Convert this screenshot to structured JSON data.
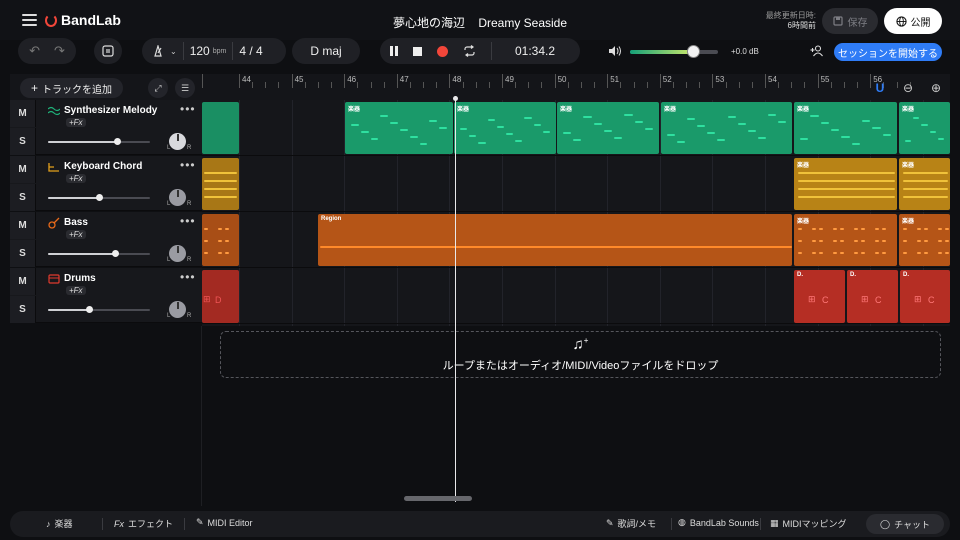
{
  "header": {
    "app_name": "BandLab",
    "project_title": "夢心地の海辺",
    "project_subtitle": "Dreamy Seaside",
    "last_saved_label": "最終更新日時:",
    "last_saved_value": "6時間前",
    "save_label": "保存",
    "publish_label": "公開"
  },
  "transport": {
    "tempo": "120",
    "tempo_unit": "bpm",
    "time_signature": "4 / 4",
    "key": "D maj",
    "time": "01:34.2",
    "master_volume": "+0.0 dB",
    "master_volume_level": 0.72,
    "session_label": "セッションを開始する"
  },
  "track_area": {
    "add_track_label": "トラックを追加"
  },
  "tracks": [
    {
      "name": "Synthesizer  Melody",
      "fx": "+Fx",
      "mute": "M",
      "solo": "S",
      "icon": "wave-icon",
      "color": "#1fb27a",
      "volume": 0.68,
      "pan": "L R"
    },
    {
      "name": "Keyboard  Chord",
      "fx": "+Fx",
      "mute": "M",
      "solo": "S",
      "icon": "keyboard-icon",
      "color": "#e3a01b",
      "volume": 0.5,
      "pan": "L R"
    },
    {
      "name": "Bass",
      "fx": "+Fx",
      "mute": "M",
      "solo": "S",
      "icon": "guitar-icon",
      "color": "#e86a1a",
      "volume": 0.66,
      "pan": "L R"
    },
    {
      "name": "Drums",
      "fx": "+Fx",
      "mute": "M",
      "solo": "S",
      "icon": "drum-icon",
      "color": "#e03a2e",
      "volume": 0.4,
      "pan": "L R"
    }
  ],
  "ruler": {
    "bars": [
      "44",
      "45",
      "46",
      "47",
      "48",
      "49",
      "50",
      "51",
      "52",
      "53",
      "54",
      "55",
      "56"
    ]
  },
  "regions": {
    "synth_label": "楽器",
    "keys_label": "楽器",
    "bass_label": "Region",
    "bass_label2": "楽器",
    "drums_label": "D.",
    "drum_pad": "C",
    "drum_pad_left": "D"
  },
  "drop_zone": {
    "text": "ループまたはオーディオ/MIDI/Videoファイルをドロップ"
  },
  "bottom_bar": {
    "instrument": "楽器",
    "effects": "エフェクト",
    "midi_editor": "MIDI Editor",
    "lyrics": "歌詞/メモ",
    "sounds": "BandLab Sounds",
    "midi_mapping": "MIDIマッピング",
    "chat": "チャット",
    "fx_prefix": "Fx"
  },
  "colors": {
    "accent": "#2f7cf6",
    "record": "#f2463a"
  }
}
